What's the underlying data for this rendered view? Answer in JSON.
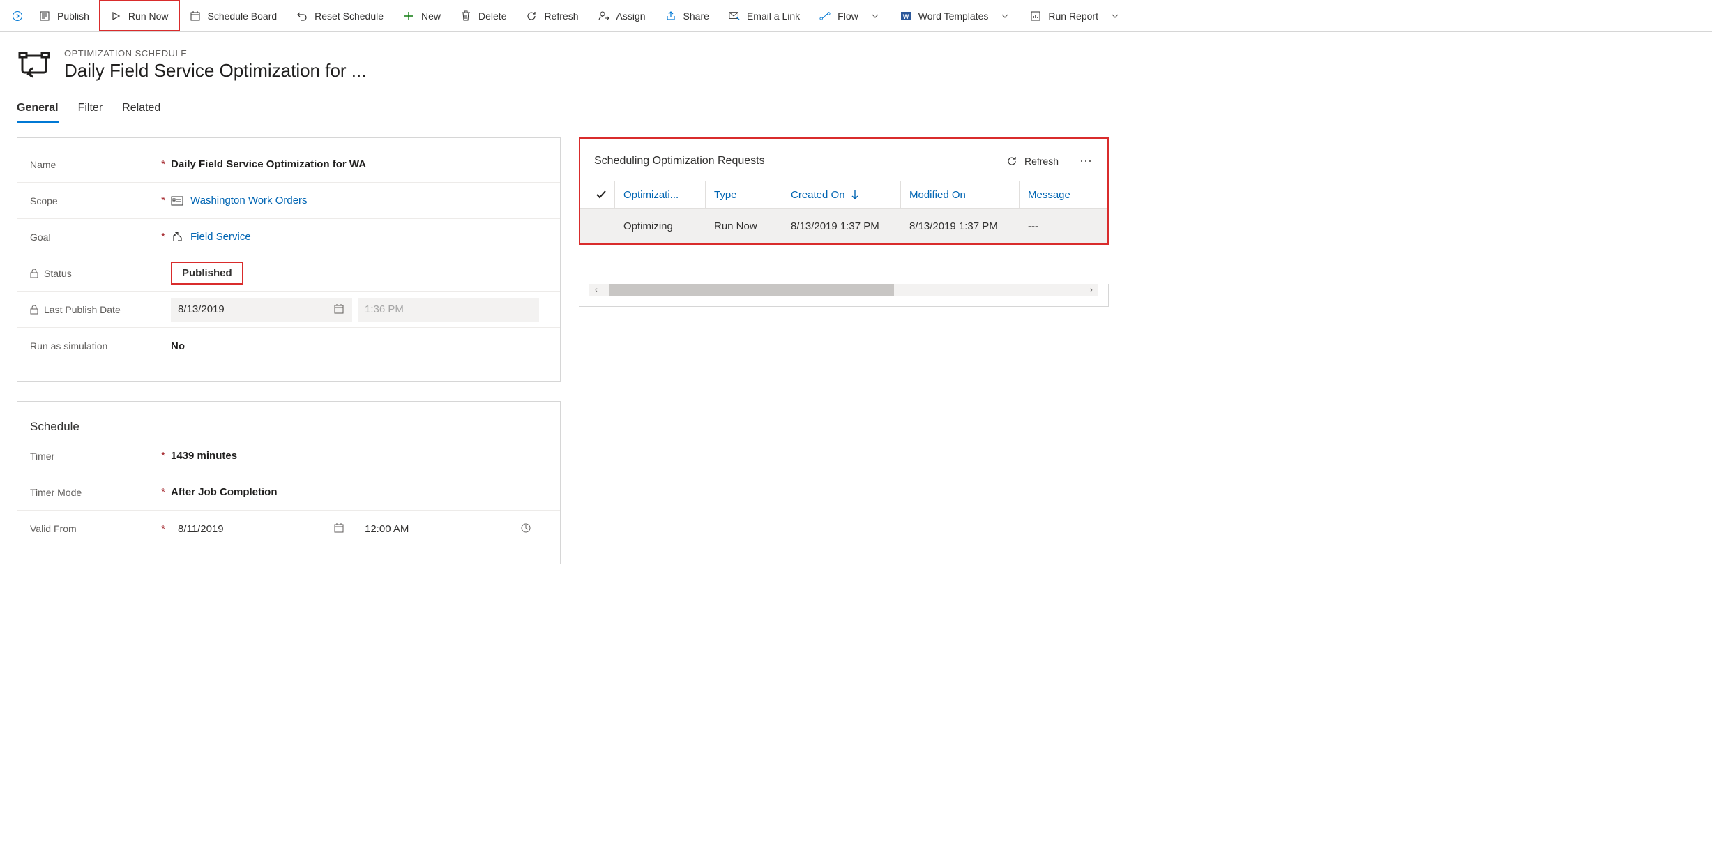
{
  "toolbar": {
    "publish": "Publish",
    "run_now": "Run Now",
    "schedule_board": "Schedule Board",
    "reset_schedule": "Reset Schedule",
    "new": "New",
    "delete": "Delete",
    "refresh": "Refresh",
    "assign": "Assign",
    "share": "Share",
    "email_link": "Email a Link",
    "flow": "Flow",
    "word_templates": "Word Templates",
    "run_report": "Run Report"
  },
  "header": {
    "entity": "OPTIMIZATION SCHEDULE",
    "title": "Daily Field Service Optimization for ..."
  },
  "tabs": {
    "general": "General",
    "filter": "Filter",
    "related": "Related"
  },
  "form": {
    "name_label": "Name",
    "name_value": "Daily Field Service Optimization for WA",
    "scope_label": "Scope",
    "scope_value": "Washington Work Orders",
    "goal_label": "Goal",
    "goal_value": "Field Service",
    "status_label": "Status",
    "status_value": "Published",
    "last_publish_label": "Last Publish Date",
    "last_publish_date": "8/13/2019",
    "last_publish_time": "1:36 PM",
    "run_sim_label": "Run as simulation",
    "run_sim_value": "No"
  },
  "schedule": {
    "title": "Schedule",
    "timer_label": "Timer",
    "timer_value": "1439 minutes",
    "timer_mode_label": "Timer Mode",
    "timer_mode_value": "After Job Completion",
    "valid_from_label": "Valid From",
    "valid_from_date": "8/11/2019",
    "valid_from_time": "12:00 AM"
  },
  "subgrid": {
    "title": "Scheduling Optimization Requests",
    "refresh": "Refresh",
    "columns": {
      "optimization": "Optimizati...",
      "type": "Type",
      "created_on": "Created On",
      "modified_on": "Modified On",
      "message": "Message"
    },
    "rows": [
      {
        "optimization": "Optimizing",
        "type": "Run Now",
        "created_on": "8/13/2019 1:37 PM",
        "modified_on": "8/13/2019 1:37 PM",
        "message": "---"
      }
    ]
  }
}
